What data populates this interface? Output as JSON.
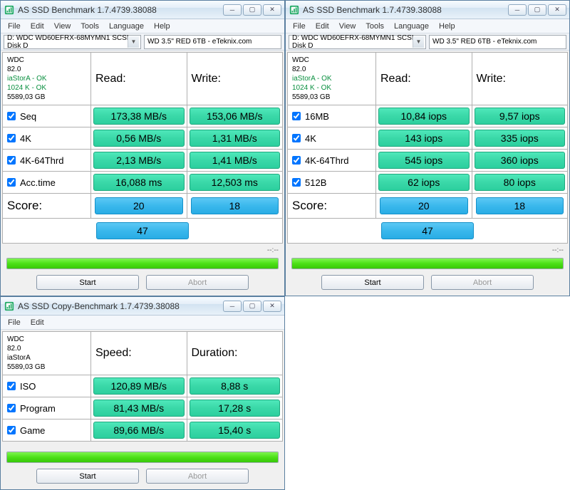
{
  "app_title_main": "AS SSD Benchmark 1.7.4739.38088",
  "app_title_copy": "AS SSD Copy-Benchmark 1.7.4739.38088",
  "menus_main": [
    "File",
    "Edit",
    "View",
    "Tools",
    "Language",
    "Help"
  ],
  "menus_copy": [
    "File",
    "Edit"
  ],
  "drive_combo": "D: WDC WD60EFRX-68MYMN1 SCSI Disk D",
  "drive_text": "WD 3.5\" RED 6TB - eTeknix.com",
  "info_main": {
    "l1": "WDC",
    "l2": "82.0",
    "l3": "iaStorA - OK",
    "l4": "1024 K - OK",
    "l5": "5589,03 GB"
  },
  "info_copy": {
    "l1": "WDC",
    "l2": "82.0",
    "l3": "iaStorA",
    "l4": "5589,03 GB"
  },
  "headers": {
    "read": "Read:",
    "write": "Write:",
    "speed": "Speed:",
    "duration": "Duration:"
  },
  "win1": {
    "rows": [
      {
        "label": "Seq",
        "read": "173,38 MB/s",
        "write": "153,06 MB/s"
      },
      {
        "label": "4K",
        "read": "0,56 MB/s",
        "write": "1,31 MB/s"
      },
      {
        "label": "4K-64Thrd",
        "read": "2,13 MB/s",
        "write": "1,41 MB/s"
      },
      {
        "label": "Acc.time",
        "read": "16,088 ms",
        "write": "12,503 ms"
      }
    ],
    "score_label": "Score:",
    "score_read": "20",
    "score_write": "18",
    "total": "47"
  },
  "win2": {
    "rows": [
      {
        "label": "16MB",
        "read": "10,84 iops",
        "write": "9,57 iops"
      },
      {
        "label": "4K",
        "read": "143 iops",
        "write": "335 iops"
      },
      {
        "label": "4K-64Thrd",
        "read": "545 iops",
        "write": "360 iops"
      },
      {
        "label": "512B",
        "read": "62 iops",
        "write": "80 iops"
      }
    ],
    "score_label": "Score:",
    "score_read": "20",
    "score_write": "18",
    "total": "47"
  },
  "win3": {
    "rows": [
      {
        "label": "ISO",
        "speed": "120,89 MB/s",
        "dur": "8,88 s"
      },
      {
        "label": "Program",
        "speed": "81,43 MB/s",
        "dur": "17,28 s"
      },
      {
        "label": "Game",
        "speed": "89,66 MB/s",
        "dur": "15,40 s"
      }
    ]
  },
  "status_text": "--:--",
  "buttons": {
    "start": "Start",
    "abort": "Abort"
  }
}
